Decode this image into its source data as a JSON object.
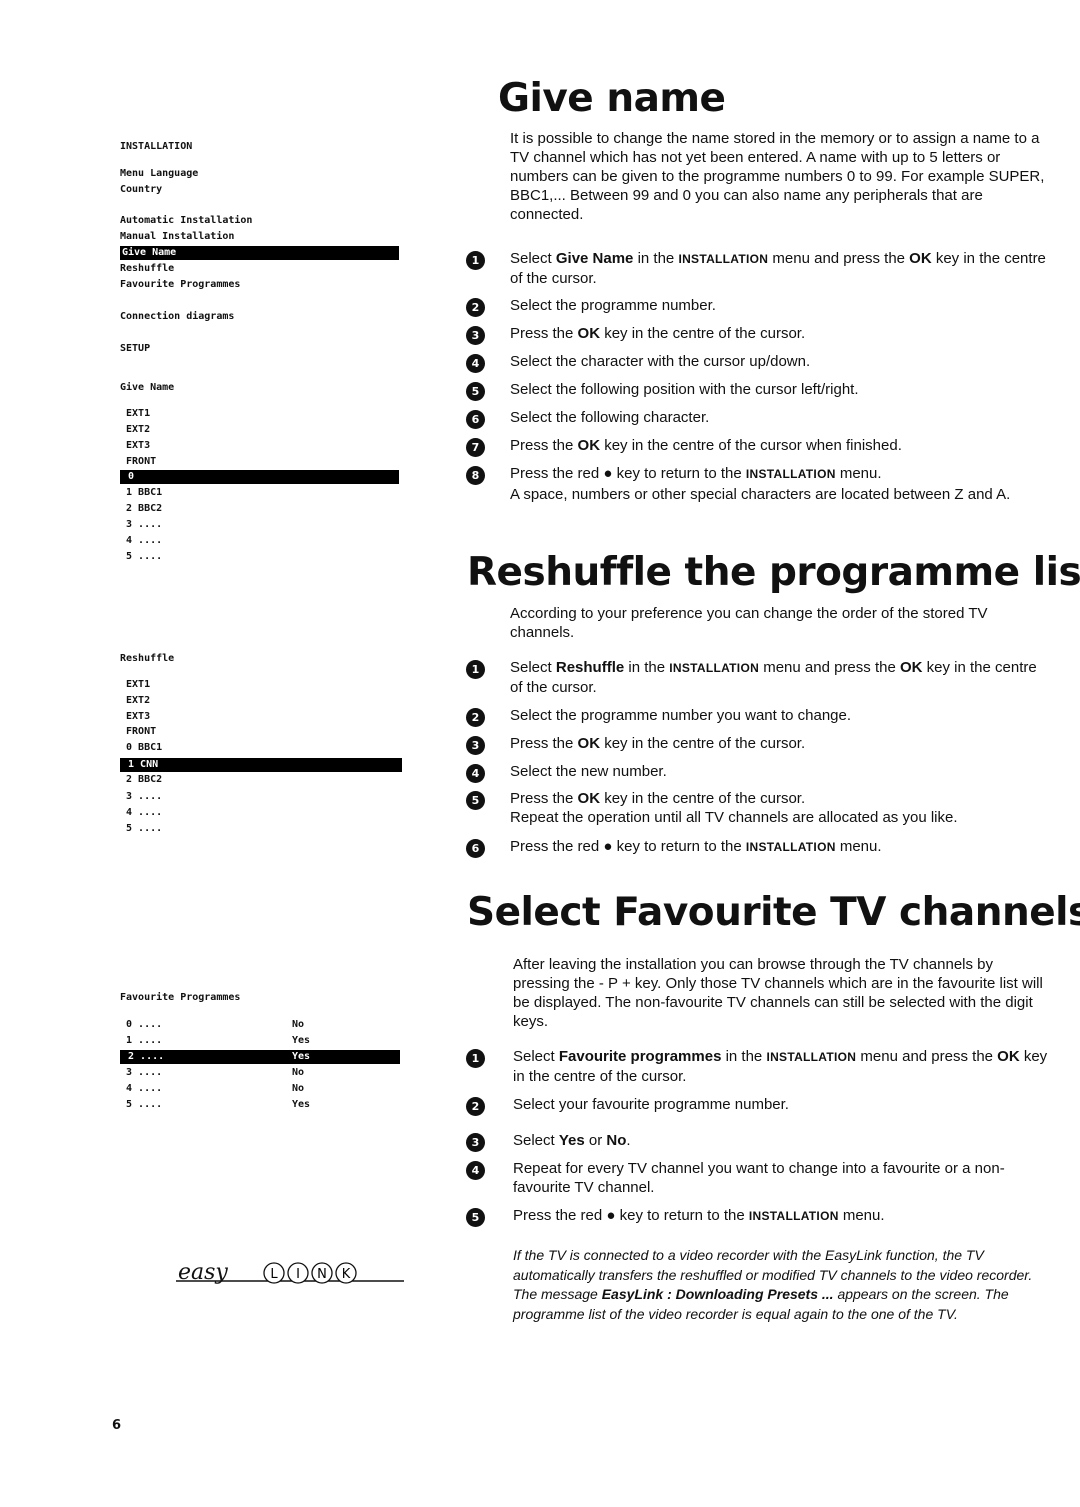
{
  "left_menus": {
    "installation": {
      "lines": [
        "INSTALLATION",
        "Menu Language",
        "Country",
        "Automatic Installation",
        "Manual Installation",
        "Give Name",
        "Reshuffle",
        "Favourite Programmes",
        "Connection diagrams",
        "SETUP"
      ],
      "highlighted_index": 5
    },
    "give_name": {
      "lines": [
        "Give Name",
        " EXT1",
        " EXT2",
        " EXT3",
        " FRONT",
        " 0",
        " 1 BBC1",
        " 2 BBC2",
        " 3 ....",
        " 4 ....",
        " 5 ...."
      ],
      "highlighted_index": 5
    },
    "reshuffle": {
      "lines": [
        "Reshuffle",
        " EXT1",
        " EXT2",
        " EXT3",
        " FRONT",
        " 0 BBC1",
        " 1 CNN",
        " 2 BBC2",
        " 3 ....",
        " 4 ....",
        " 5 ...."
      ],
      "highlighted_index": 6
    },
    "favourite": {
      "title": "Favourite Programmes",
      "rows": [
        {
          "prog": " 0 ....",
          "value": "No"
        },
        {
          "prog": " 1 ....",
          "value": "Yes"
        },
        {
          "prog": " 2 ....",
          "value": "Yes"
        },
        {
          "prog": " 3 ....",
          "value": "No"
        },
        {
          "prog": " 4 ....",
          "value": "No"
        },
        {
          "prog": " 5 ....",
          "value": "Yes"
        }
      ],
      "highlighted_index": 2
    }
  },
  "sections": [
    {
      "title": "Give name",
      "intro": "It is possible to change the name stored in the memory or to assign a name to a TV channel which has not yet been entered. A name with up to 5 letters or numbers can be given to the programme numbers 0 to 99. For example SUPER, BBC1,... Between 99 and 0 you can also name any peripherals that are connected.",
      "steps": [
        [
          {
            "t": "Select "
          },
          {
            "t": "Give Name",
            "s": "b"
          },
          {
            "t": " in the "
          },
          {
            "t": "INSTALLATION",
            "s": "sc"
          },
          {
            "t": " menu and press the "
          },
          {
            "t": "OK",
            "s": "b"
          },
          {
            "t": " key in the centre of the cursor."
          }
        ],
        [
          {
            "t": "Select the programme number."
          }
        ],
        [
          {
            "t": "Press the "
          },
          {
            "t": "OK",
            "s": "b"
          },
          {
            "t": " key in the centre of the cursor."
          }
        ],
        [
          {
            "t": "Select the character with the cursor up/down."
          }
        ],
        [
          {
            "t": "Select the following position with the cursor left/right."
          }
        ],
        [
          {
            "t": "Select the following character."
          }
        ],
        [
          {
            "t": "Press the "
          },
          {
            "t": "OK",
            "s": "b"
          },
          {
            "t": " key in the centre of the cursor when finished."
          }
        ],
        [
          {
            "t": "Press the red "
          },
          {
            "t": "●",
            "s": "b"
          },
          {
            "t": " key to return to the "
          },
          {
            "t": "INSTALLATION",
            "s": "sc"
          },
          {
            "t": " menu."
          }
        ]
      ],
      "note": "A space, numbers or other special characters are located between Z and A."
    },
    {
      "title": "Reshuffle the programme list",
      "intro": "According to your preference you can change the order of the stored TV channels.",
      "steps": [
        [
          {
            "t": "Select "
          },
          {
            "t": "Reshuffle",
            "s": "b"
          },
          {
            "t": " in the "
          },
          {
            "t": "INSTALLATION",
            "s": "sc"
          },
          {
            "t": " menu and press the "
          },
          {
            "t": "OK",
            "s": "b"
          },
          {
            "t": " key in the centre of the cursor."
          }
        ],
        [
          {
            "t": "Select the programme number you want to change."
          }
        ],
        [
          {
            "t": "Press the "
          },
          {
            "t": "OK",
            "s": "b"
          },
          {
            "t": " key in the centre of the cursor."
          }
        ],
        [
          {
            "t": "Select the new number."
          }
        ],
        [
          {
            "t": "Press the "
          },
          {
            "t": "OK",
            "s": "b"
          },
          {
            "t": " key in the centre of the cursor."
          },
          {
            "t": "\nRepeat the operation until all TV channels are allocated as you like."
          }
        ],
        [
          {
            "t": "Press the red "
          },
          {
            "t": "●",
            "s": "b"
          },
          {
            "t": " key to return to the "
          },
          {
            "t": "INSTALLATION",
            "s": "sc"
          },
          {
            "t": " menu."
          }
        ]
      ]
    },
    {
      "title": "Select Favourite TV channels",
      "intro": "After leaving the installation you can browse through the TV channels by pressing the - P + key.  Only those TV channels which are in the favourite list will be displayed. The non-favourite TV channels can still be selected with the digit keys.",
      "steps": [
        [
          {
            "t": "Select "
          },
          {
            "t": "Favourite programmes",
            "s": "b"
          },
          {
            "t": " in the "
          },
          {
            "t": "INSTALLATION",
            "s": "sc"
          },
          {
            "t": " menu and press the "
          },
          {
            "t": "OK",
            "s": "b"
          },
          {
            "t": " key in the centre of the cursor."
          }
        ],
        [
          {
            "t": "Select your favourite programme number."
          }
        ],
        [
          {
            "t": "Select "
          },
          {
            "t": "Yes",
            "s": "b"
          },
          {
            "t": " or "
          },
          {
            "t": "No",
            "s": "b"
          },
          {
            "t": "."
          }
        ],
        [
          {
            "t": "Repeat for every TV channel you want to change into a favourite or a non-favourite TV channel."
          }
        ],
        [
          {
            "t": "Press the red "
          },
          {
            "t": "●",
            "s": "b"
          },
          {
            "t": " key to return to the "
          },
          {
            "t": "INSTALLATION",
            "s": "sc"
          },
          {
            "t": " menu."
          }
        ]
      ],
      "easylink_note": [
        {
          "t": "If the TV is connected to a video recorder with the EasyLink function, the TV automatically transfers the reshuffled or modified TV channels to the video recorder. The message "
        },
        {
          "t": "EasyLink : Downloading Presets ...",
          "s": "b"
        },
        {
          "t": "  appears on the screen.  The programme list of the video recorder is equal again to the one of the TV."
        }
      ]
    }
  ],
  "logo": {
    "script": "easy",
    "letters": [
      "L",
      "I",
      "N",
      "K"
    ]
  },
  "page_number": "6"
}
